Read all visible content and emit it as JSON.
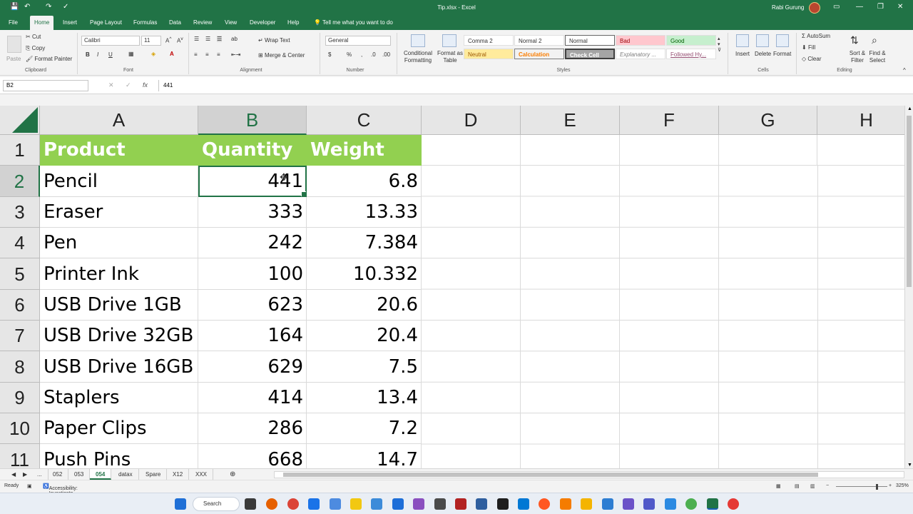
{
  "titlebar": {
    "title": "Tip.xlsx - Excel",
    "user": "Rabi Gurung"
  },
  "tabs": [
    "File",
    "Home",
    "Insert",
    "Page Layout",
    "Formulas",
    "Data",
    "Review",
    "View",
    "Developer",
    "Help"
  ],
  "tell_me": "Tell me what you want to do",
  "ribbon": {
    "clipboard": {
      "paste": "Paste",
      "cut": "Cut",
      "copy": "Copy",
      "format_painter": "Format Painter",
      "label": "Clipboard"
    },
    "font": {
      "name": "Calibri",
      "size": "11",
      "label": "Font"
    },
    "alignment": {
      "wrap": "Wrap Text",
      "merge": "Merge & Center",
      "label": "Alignment"
    },
    "number": {
      "format": "General",
      "label": "Number"
    },
    "styles": {
      "conditional": "Conditional Formatting",
      "format_table": "Format as Table",
      "cells": [
        "Comma 2",
        "Normal 2",
        "Normal",
        "Bad",
        "Good",
        "Neutral",
        "Calculation",
        "Check Cell",
        "Explanatory ...",
        "Followed Hy..."
      ],
      "label": "Styles"
    },
    "cells": {
      "insert": "Insert",
      "delete": "Delete",
      "format": "Format",
      "label": "Cells"
    },
    "editing": {
      "autosum": "AutoSum",
      "fill": "Fill",
      "clear": "Clear",
      "sort": "Sort & Filter",
      "find": "Find & Select",
      "label": "Editing"
    }
  },
  "formula_bar": {
    "name_box": "B2",
    "fx": "fx",
    "value": "441"
  },
  "columns": [
    "A",
    "B",
    "C",
    "D",
    "E",
    "F",
    "G",
    "H"
  ],
  "rows": [
    "1",
    "2",
    "3",
    "4",
    "5",
    "6",
    "7",
    "8",
    "9",
    "10",
    "11"
  ],
  "sheet": {
    "header": [
      "Product",
      "Quantity",
      "Weight"
    ],
    "data": [
      [
        "Pencil",
        "441",
        "6.8"
      ],
      [
        "Eraser",
        "333",
        "13.33"
      ],
      [
        "Pen",
        "242",
        "7.384"
      ],
      [
        "Printer Ink",
        "100",
        "10.332"
      ],
      [
        "USB Drive 1GB",
        "623",
        "20.6"
      ],
      [
        "USB Drive 32GB",
        "164",
        "20.4"
      ],
      [
        "USB Drive 16GB",
        "629",
        "7.5"
      ],
      [
        "Staplers",
        "414",
        "13.4"
      ],
      [
        "Paper Clips",
        "286",
        "7.2"
      ],
      [
        "Push Pins",
        "668",
        "14.7"
      ]
    ]
  },
  "sheet_tabs": [
    "...",
    "052",
    "053",
    "054",
    "datax",
    "Spare",
    "X12",
    "XXX"
  ],
  "active_sheet": "054",
  "status": {
    "ready": "Ready",
    "accessibility": "Accessibility: Investigate",
    "zoom": "325%"
  },
  "taskbar": {
    "search": "Search"
  },
  "colors": {
    "excel_green": "#217346",
    "header_fill": "#92d050"
  }
}
